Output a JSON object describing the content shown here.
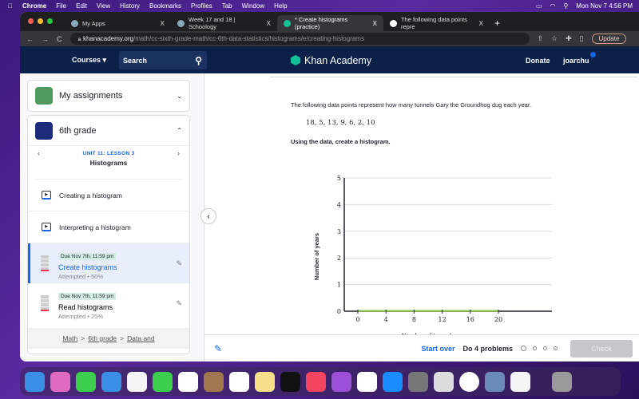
{
  "menubar": {
    "app": "Chrome",
    "items": [
      "File",
      "Edit",
      "View",
      "History",
      "Bookmarks",
      "Profiles",
      "Tab",
      "Window",
      "Help"
    ],
    "datetime": "Mon Nov 7  4:56 PM"
  },
  "browser": {
    "tabs": [
      {
        "label": "My Apps"
      },
      {
        "label": "Week 17 and 18 | Schoology"
      },
      {
        "label": "* Create histograms (practice)"
      },
      {
        "label": "The following data points repre"
      }
    ],
    "url_domain": "khanacademy.org",
    "url_path": "/math/cc-sixth-grade-math/cc-6th-data-statistics/histograms/e/creating-histograms",
    "update_label": "Update"
  },
  "nav": {
    "courses": "Courses",
    "search_placeholder": "Search",
    "brand": "Khan Academy",
    "donate": "Donate",
    "user": "joarchu"
  },
  "sidebar": {
    "assignments": "My assignments",
    "course": "6th grade",
    "unit": "UNIT 11: LESSON 3",
    "lesson": "Histograms",
    "videos": [
      {
        "label": "Creating a histogram"
      },
      {
        "label": "Interpreting a histogram"
      }
    ],
    "exercises": [
      {
        "due": "Due Nov 7th, 11:59 pm",
        "label": "Create histograms",
        "status": "Attempted • 50%"
      },
      {
        "due": "Due Nov 7th, 11:59 pm",
        "label": "Read histograms",
        "status": "Attempted • 25%"
      }
    ],
    "breadcrumb": [
      "Math",
      "6th grade",
      "Data and"
    ]
  },
  "question": {
    "prompt": "The following data points represent how many tunnels Gary the Groundhog dug each year.",
    "data": "18, 5, 13, 9, 6, 2, 10",
    "instruction": "Using the data, create a histogram."
  },
  "chart_data": {
    "type": "bar",
    "xlabel": "Number of tunnels",
    "ylabel": "Number of years",
    "x_ticks": [
      0,
      4,
      8,
      12,
      16,
      20
    ],
    "y_ticks": [
      0,
      1,
      2,
      3,
      4,
      5
    ],
    "xlim": [
      0,
      20
    ],
    "ylim": [
      0,
      5
    ],
    "bins": [
      [
        0,
        4
      ],
      [
        4,
        8
      ],
      [
        8,
        12
      ],
      [
        12,
        16
      ],
      [
        16,
        20
      ]
    ],
    "values": [
      0,
      0,
      0,
      0,
      0
    ],
    "grid": true,
    "bar_color": "#8bc34a"
  },
  "footer": {
    "start_over": "Start over",
    "progress": "Do 4 problems",
    "check": "Check"
  }
}
